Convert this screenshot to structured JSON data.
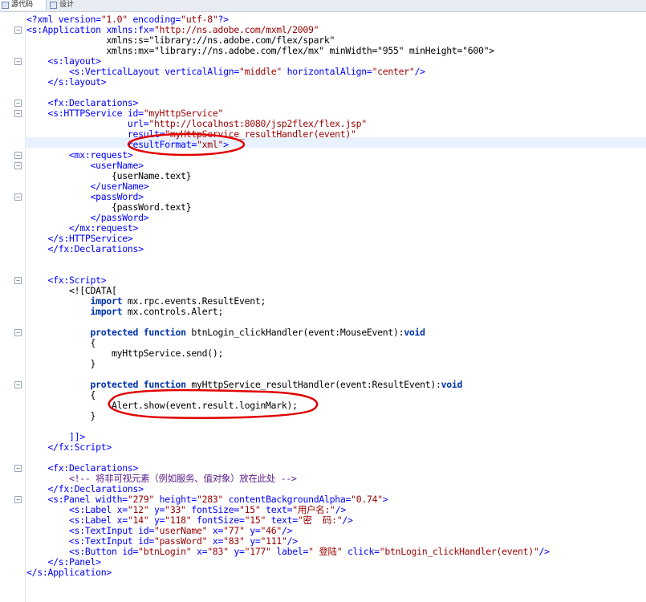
{
  "editor": {
    "tabs": [
      {
        "label": "源代码",
        "active": true
      },
      {
        "label": "设计",
        "active": false
      }
    ],
    "colors": {
      "tag": "#0000ff",
      "string": "#990000",
      "keyword": "#0033aa",
      "comment": "#5a1a8a",
      "current_line": "#e8f2fe",
      "annotation": "#e00000"
    },
    "code_lines": [
      "<?xml version=\"1.0\" encoding=\"utf-8\"?>",
      "<s:Application xmlns:fx=\"http://ns.adobe.com/mxml/2009\"",
      "               xmlns:s=\"library://ns.adobe.com/flex/spark\"",
      "               xmlns:mx=\"library://ns.adobe.com/flex/mx\" minWidth=\"955\" minHeight=\"600\">",
      "    <s:layout>",
      "        <s:VerticalLayout verticalAlign=\"middle\" horizontalAlign=\"center\"/>",
      "    </s:layout>",
      "",
      "    <fx:Declarations>",
      "    <s:HTTPService id=\"myHttpService\"",
      "                   url=\"http://localhost:8080/jsp2flex/flex.jsp\"",
      "                   result=\"myHttpService_resultHandler(event)\"",
      "                   resultFormat=\"xml\">",
      "        <mx:request>",
      "            <userName>",
      "                {userName.text}",
      "            </userName>",
      "            <passWord>",
      "                {passWord.text}",
      "            </passWord>",
      "        </mx:request>",
      "    </s:HTTPService>",
      "    </fx:Declarations>",
      "",
      "",
      "    <fx:Script>",
      "        <![CDATA[",
      "            import mx.rpc.events.ResultEvent;",
      "            import mx.controls.Alert;",
      "",
      "            protected function btnLogin_clickHandler(event:MouseEvent):void",
      "            {",
      "                myHttpService.send();",
      "            }",
      "",
      "            protected function myHttpService_resultHandler(event:ResultEvent):void",
      "            {",
      "                Alert.show(event.result.loginMark);",
      "            }",
      "",
      "        ]]>",
      "    </fx:Script>",
      "",
      "    <fx:Declarations>",
      "        <!-- 将非可视元素（例如服务、值对象）放在此处 -->",
      "    </fx:Declarations>",
      "    <s:Panel width=\"279\" height=\"283\" contentBackgroundAlpha=\"0.74\">",
      "        <s:Label x=\"12\" y=\"33\" fontSize=\"15\" text=\"用户名:\"/>",
      "        <s:Label x=\"14\" y=\"118\" fontSize=\"15\" text=\"密  码:\"/>",
      "        <s:TextInput id=\"userName\" x=\"77\" y=\"46\"/>",
      "        <s:TextInput id=\"passWord\" x=\"83\" y=\"111\"/>",
      "        <s:Button id=\"btnLogin\" x=\"83\" y=\"177\" label=\" 登陆\" click=\"btnLogin_clickHandler(event)\"/>",
      "    </s:Panel>",
      "</s:Application>"
    ],
    "fold_markers": [
      1,
      4,
      8,
      9,
      13,
      14,
      17,
      25,
      30,
      35,
      43,
      46
    ]
  }
}
